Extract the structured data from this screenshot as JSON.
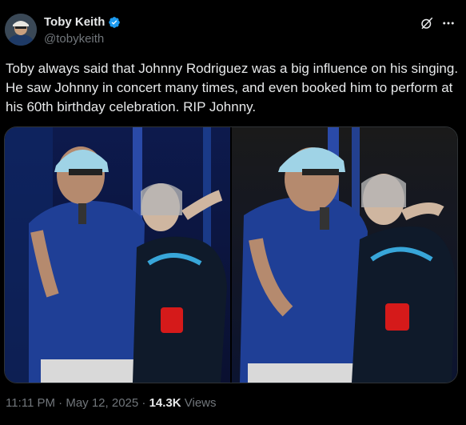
{
  "author": {
    "name": "Toby Keith",
    "handle": "@tobykeith",
    "verified": true,
    "avatar_icon": "profile-photo"
  },
  "actions": {
    "grok_icon": "grok-icon",
    "more_icon": "more-icon"
  },
  "tweet": {
    "text": "Toby always said that Johnny Rodriguez was a big influence on his singing. He saw Johnny in concert many times, and even booked him to perform at his 60th birthday celebration. RIP Johnny."
  },
  "media": {
    "count": 2,
    "photos": [
      {
        "description_icon": "concert-photo"
      },
      {
        "description_icon": "concert-photo"
      }
    ]
  },
  "meta": {
    "time": "11:11 PM",
    "separator": " · ",
    "date": "May 12, 2025",
    "views_count": "14.3K",
    "views_label": " Views"
  },
  "colors": {
    "background": "#000000",
    "text": "#e7e9ea",
    "secondary": "#71767b",
    "verified": "#1d9bf0"
  }
}
